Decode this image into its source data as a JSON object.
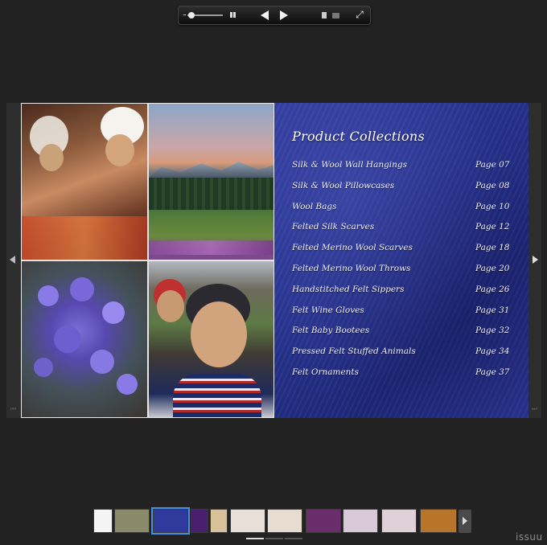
{
  "right_page": {
    "title": "Product Collections",
    "toc": [
      {
        "title": "Silk & Wool Wall Hangings",
        "page": "Page 07"
      },
      {
        "title": "Silk & Wool Pillowcases",
        "page": "Page 08"
      },
      {
        "title": "Wool Bags",
        "page": "Page 10"
      },
      {
        "title": "Felted Silk Scarves",
        "page": "Page 12"
      },
      {
        "title": "Felted Merino Wool Scarves",
        "page": "Page 18"
      },
      {
        "title": "Felted Merino Wool Throws",
        "page": "Page 20"
      },
      {
        "title": "Handstitched Felt Sippers",
        "page": "Page 26"
      },
      {
        "title": "Felt Wine Gloves",
        "page": "Page 31"
      },
      {
        "title": "Felt Baby Bootees",
        "page": "Page 32"
      },
      {
        "title": "Pressed Felt Stuffed Animals",
        "page": "Page 34"
      },
      {
        "title": "Felt Ornaments",
        "page": "Page 37"
      }
    ]
  },
  "toolbar": {
    "icons": [
      "zoom-slider",
      "two-page-view-icon",
      "previous-icon",
      "next-icon",
      "document-icon",
      "grid-icon",
      "fullscreen-icon"
    ]
  },
  "thumbnails": {
    "count": 11,
    "active_index": 2,
    "colors": [
      "#f4f4f4",
      "#8a8a6a",
      "#2f3a9c",
      "#4a1f6e",
      "#d9c29a",
      "#e8e0d8",
      "#e6dcd0",
      "#6a2c6a",
      "#d8c8d8",
      "#e0d0d8",
      "#b8742a"
    ]
  },
  "pager": {
    "pages": 3,
    "active_index": 0
  },
  "brand": {
    "name": "issuu"
  },
  "colors": {
    "background": "#222222",
    "page_blue": "#24308a",
    "thumb_active": "#4a90d9"
  }
}
